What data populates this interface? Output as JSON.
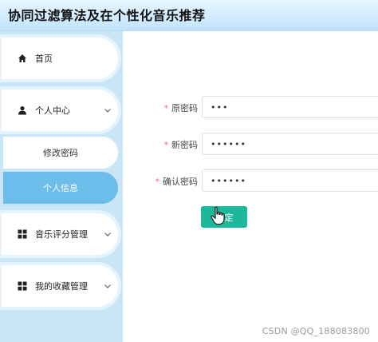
{
  "app": {
    "title": "协同过滤算法及在个性化音乐推荐"
  },
  "sidebar": {
    "home": {
      "label": "首页",
      "icon": "home-icon"
    },
    "personal_center": {
      "label": "个人中心",
      "icon": "user-icon",
      "expanded": true,
      "children": [
        {
          "label": "修改密码",
          "active": false
        },
        {
          "label": "个人信息",
          "active": true
        }
      ]
    },
    "music_rating": {
      "label": "音乐评分管理",
      "icon": "grid-icon"
    },
    "favorites": {
      "label": "我的收藏管理",
      "icon": "grid-icon"
    }
  },
  "form": {
    "old_password": {
      "label": "原密码",
      "value": "•••"
    },
    "new_password": {
      "label": "新密码",
      "value": "••••••"
    },
    "confirm_password": {
      "label": "确认密码",
      "value": "••••••"
    },
    "submit_label": "定"
  },
  "watermark": "CSDN @QQ_188083800",
  "colors": {
    "sidebar_bg": "#c9e6f7",
    "active_item": "#6cbde9",
    "primary_button": "#1db89a",
    "required_mark": "#f56c6c"
  }
}
